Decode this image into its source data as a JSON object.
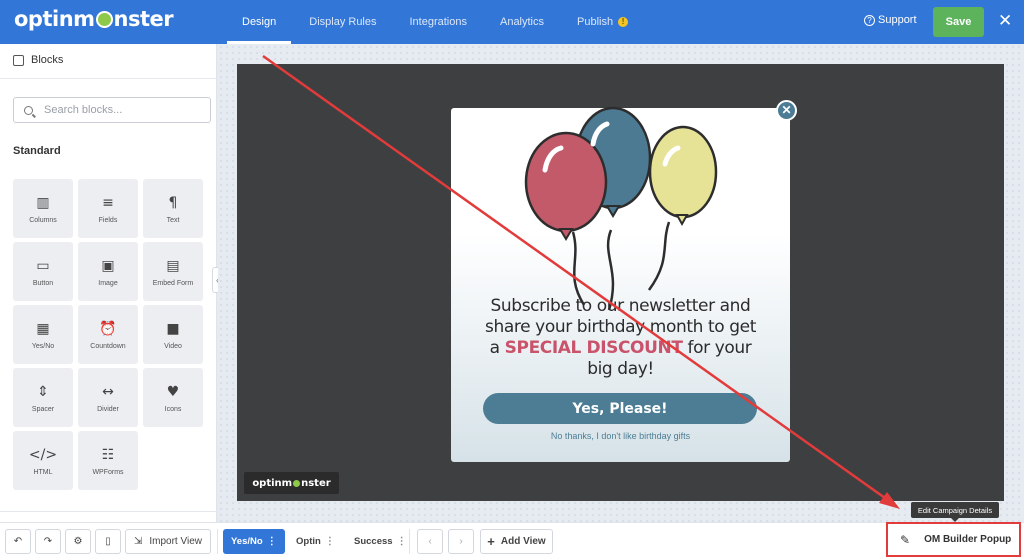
{
  "header": {
    "logo_left": "optinm",
    "logo_right": "nster",
    "tabs": [
      {
        "label": "Design"
      },
      {
        "label": "Display Rules"
      },
      {
        "label": "Integrations"
      },
      {
        "label": "Analytics"
      },
      {
        "label": "Publish"
      }
    ],
    "publish_badge": "!",
    "support_label": "Support",
    "save_label": "Save",
    "close_glyph": "✕"
  },
  "sidebar": {
    "title": "Blocks",
    "search_placeholder": "Search blocks...",
    "section_title": "Standard",
    "blocks": [
      {
        "label": "Columns",
        "icon": "columns-icon"
      },
      {
        "label": "Fields",
        "icon": "fields-icon"
      },
      {
        "label": "Text",
        "icon": "paragraph-icon"
      },
      {
        "label": "Button",
        "icon": "button-icon"
      },
      {
        "label": "Image",
        "icon": "image-icon"
      },
      {
        "label": "Embed Form",
        "icon": "embed-icon"
      },
      {
        "label": "Yes/No",
        "icon": "yes-no-icon"
      },
      {
        "label": "Countdown",
        "icon": "alarm-icon"
      },
      {
        "label": "Video",
        "icon": "video-icon"
      },
      {
        "label": "Spacer",
        "icon": "spacer-icon"
      },
      {
        "label": "Divider",
        "icon": "divider-icon"
      },
      {
        "label": "Icons",
        "icon": "heart-icon"
      },
      {
        "label": "HTML",
        "icon": "code-icon"
      },
      {
        "label": "WPForms",
        "icon": "wpforms-icon"
      }
    ]
  },
  "popup": {
    "headline_line1": "Subscribe to our newsletter and",
    "headline_line2": "share your birthday month to get",
    "headline_pre": "a ",
    "headline_highlight": "SPECIAL DISCOUNT",
    "headline_post": " for your",
    "headline_line4": "big day!",
    "yes_label": "Yes, Please!",
    "no_label": "No thanks, I don't like birthday gifts",
    "close_glyph": "✕",
    "balloon_colors": [
      "#c25a6a",
      "#4b7a92",
      "#e6e296"
    ]
  },
  "watermark": {
    "left": "optinm",
    "right": "nster"
  },
  "bottom": {
    "import_label": "Import View",
    "views": [
      {
        "label": "Yes/No"
      },
      {
        "label": "Optin"
      },
      {
        "label": "Success"
      }
    ],
    "add_view_label": "Add View",
    "campaign_name": "OM Builder Popup",
    "tooltip": "Edit Campaign Details"
  },
  "colors": {
    "brand_blue": "#3277d8",
    "save_green": "#5cb35c",
    "highlight": "#c9536a",
    "annotation_red": "#e23b3b"
  }
}
